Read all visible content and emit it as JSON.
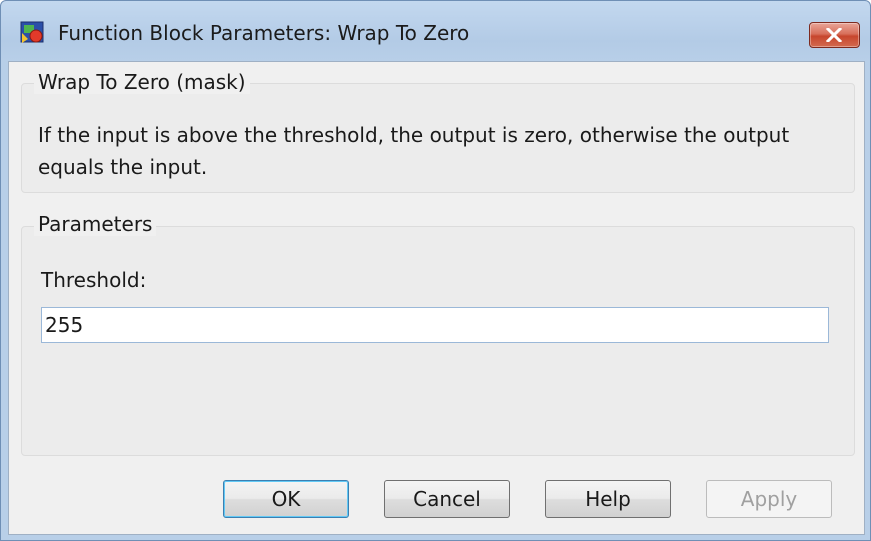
{
  "window": {
    "title": "Function Block Parameters: Wrap To Zero",
    "app_icon": "simulink-block-icon",
    "close_icon": "close-x-icon"
  },
  "description": {
    "group_title": "Wrap To Zero (mask)",
    "text": "If the input is above the threshold, the output is zero, otherwise the output equals the input."
  },
  "parameters": {
    "group_title": "Parameters",
    "threshold_label": "Threshold:",
    "threshold_value": "255"
  },
  "buttons": {
    "ok": "OK",
    "cancel": "Cancel",
    "help": "Help",
    "apply": "Apply"
  },
  "colors": {
    "close_button": "#c7462d",
    "titlebar": "#b3cbe6",
    "dialog_background": "#f0f0f0"
  }
}
